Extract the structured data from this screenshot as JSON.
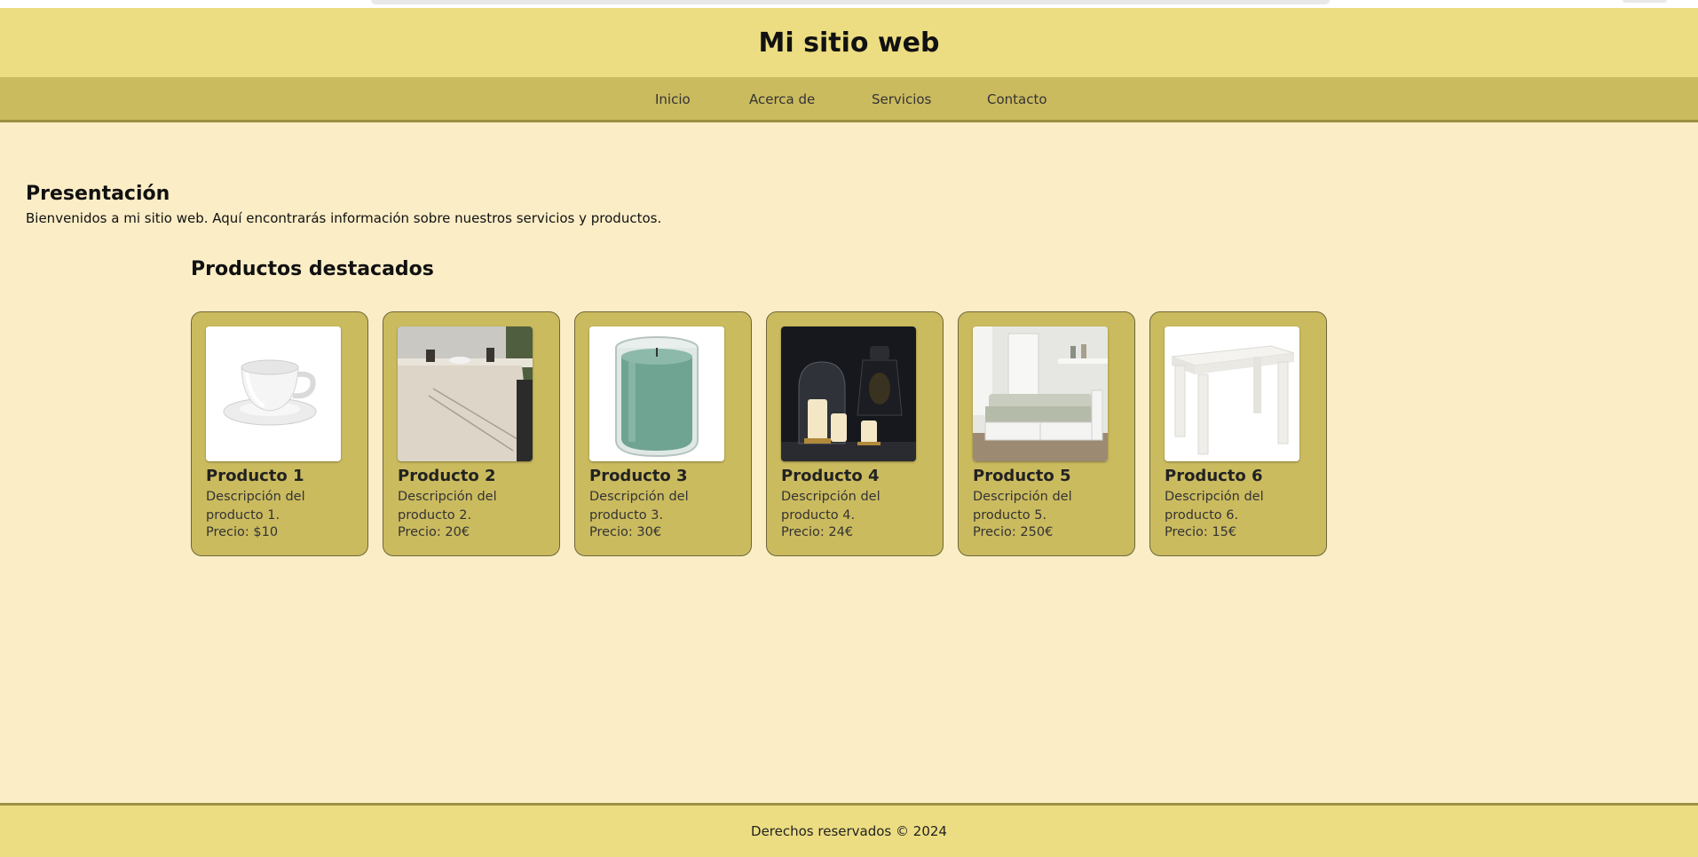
{
  "site": {
    "title": "Mi sitio web"
  },
  "nav": {
    "items": [
      {
        "label": "Inicio"
      },
      {
        "label": "Acerca de"
      },
      {
        "label": "Servicios"
      },
      {
        "label": "Contacto"
      }
    ]
  },
  "intro": {
    "title": "Presentación",
    "text": "Bienvenidos a mi sitio web. Aquí encontrarás información sobre nuestros servicios y productos."
  },
  "products": {
    "title": "Productos destacados",
    "items": [
      {
        "name": "Producto 1",
        "description": "Descripción del producto 1.",
        "price": "Precio: $10",
        "image": "white-teacup"
      },
      {
        "name": "Producto 2",
        "description": "Descripción del producto 2.",
        "price": "Precio: 20€",
        "image": "tablecloth-dining"
      },
      {
        "name": "Producto 3",
        "description": "Descripción del producto 3.",
        "price": "Precio: 30€",
        "image": "green-candle-jar"
      },
      {
        "name": "Producto 4",
        "description": "Descripción del producto 4.",
        "price": "Precio: 24€",
        "image": "candles-lantern"
      },
      {
        "name": "Producto 5",
        "description": "Descripción del producto 5.",
        "price": "Precio: 250€",
        "image": "white-daybed"
      },
      {
        "name": "Producto 6",
        "description": "Descripción del producto 6.",
        "price": "Precio: 15€",
        "image": "white-side-table"
      }
    ]
  },
  "footer": {
    "text": "Derechos reservados © 2024"
  },
  "colors": {
    "header": "#ecdd82",
    "nav": "#cbbb5f",
    "background": "#fbedc6",
    "card": "#cbbb5f"
  }
}
